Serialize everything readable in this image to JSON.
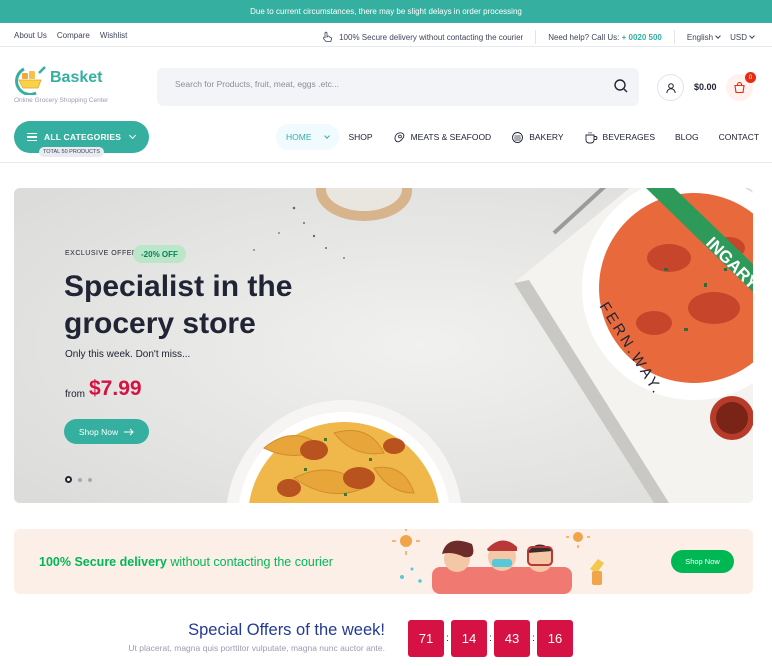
{
  "topbar": {
    "notice": "Due to current circumstances, there may be slight delays in order processing"
  },
  "subbar": {
    "links": [
      "About Us",
      "Compare",
      "Wishlist"
    ],
    "secure": "100% Secure delivery without contacting the courier",
    "help_label": "Need help? Call Us:",
    "phone": "+ 0020 500",
    "language": "English",
    "currency": "USD"
  },
  "logo": {
    "name": "Basket",
    "tagline": "Online Grocery Shopping Center"
  },
  "search": {
    "placeholder": "Search for Products, fruit, meat, eggs .etc..."
  },
  "header": {
    "cart_total": "$0.00",
    "cart_count": "0"
  },
  "categories": {
    "label": "ALL CATEGORIES",
    "total": "TOTAL 50 PRODUCTS"
  },
  "nav": [
    {
      "label": "HOME",
      "icon": "",
      "active": true
    },
    {
      "label": "SHOP",
      "icon": ""
    },
    {
      "label": "MEATS & SEAFOOD",
      "icon": "meat-icon"
    },
    {
      "label": "BAKERY",
      "icon": "bakery-icon"
    },
    {
      "label": "BEVERAGES",
      "icon": "cup-icon"
    },
    {
      "label": "BLOG",
      "icon": ""
    },
    {
      "label": "CONTACT",
      "icon": ""
    }
  ],
  "hero": {
    "eyebrow": "EXCLUSIVE OFFER",
    "discount": "-20% OFF",
    "title": "Specialist in the grocery store",
    "subtitle": "Only this week. Don't miss...",
    "from": "from",
    "price": "$7.99",
    "cta": "Shop Now",
    "book_text": "FERN.WAY.",
    "book_band": "INGARY"
  },
  "banner": {
    "bold": "100% Secure delivery",
    "text": " without contacting the courier",
    "cta": "Shop Now"
  },
  "offers": {
    "title": "Special Offers of the week!",
    "subtitle": "Ut placerat, magna quis porttitor vulputate, magna nunc auctor ante.",
    "countdown": [
      "71",
      "14",
      "43",
      "16"
    ]
  },
  "colors": {
    "brand": "#35afa0",
    "price": "#d51243",
    "green": "#00b853",
    "navy": "#233a95"
  }
}
